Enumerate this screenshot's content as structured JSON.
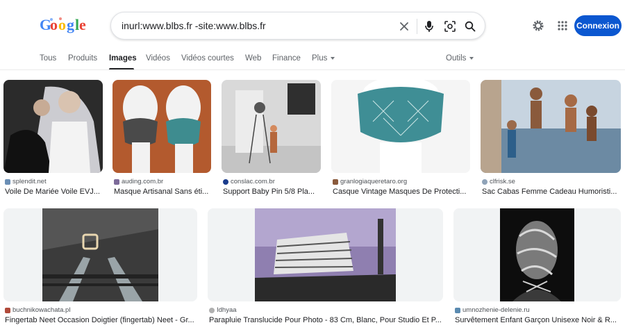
{
  "logo": {
    "text": "Google"
  },
  "search": {
    "query": "inurl:www.blbs.fr -site:www.blbs.fr"
  },
  "header": {
    "signin_label": "Connexion"
  },
  "tabs": [
    {
      "label": "Tous"
    },
    {
      "label": "Produits"
    },
    {
      "label": "Images"
    },
    {
      "label": "Vidéos"
    },
    {
      "label": "Vidéos courtes"
    },
    {
      "label": "Web"
    },
    {
      "label": "Finance"
    },
    {
      "label": "Plus"
    }
  ],
  "tools_label": "Outils",
  "results": [
    {
      "source": "splendit.net",
      "title": "Voile De Mariée Voile EVJ..."
    },
    {
      "source": "auding.com.br",
      "title": "Masque Artisanal Sans éti..."
    },
    {
      "source": "conslac.com.br",
      "title": "Support Baby Pin 5/8 Pla..."
    },
    {
      "source": "granlogiaqueretaro.org",
      "title": "Casque Vintage Masques De Protecti..."
    },
    {
      "source": "clfrisk.se",
      "title": "Sac Cabas Femme Cadeau Humoristi..."
    },
    {
      "source": "buchnikowachata.pl",
      "title": "Fingertab Neet Occasion Doigtier (fingertab) Neet - Gr..."
    },
    {
      "source": "Idhyaa",
      "title": "Parapluie Translucide Pour Photo - 83 Cm, Blanc, Pour Studio Et P..."
    },
    {
      "source": "umnozhenie-delenie.ru",
      "title": "Survêtement Enfant Garçon Unisexe Noir & R..."
    }
  ]
}
